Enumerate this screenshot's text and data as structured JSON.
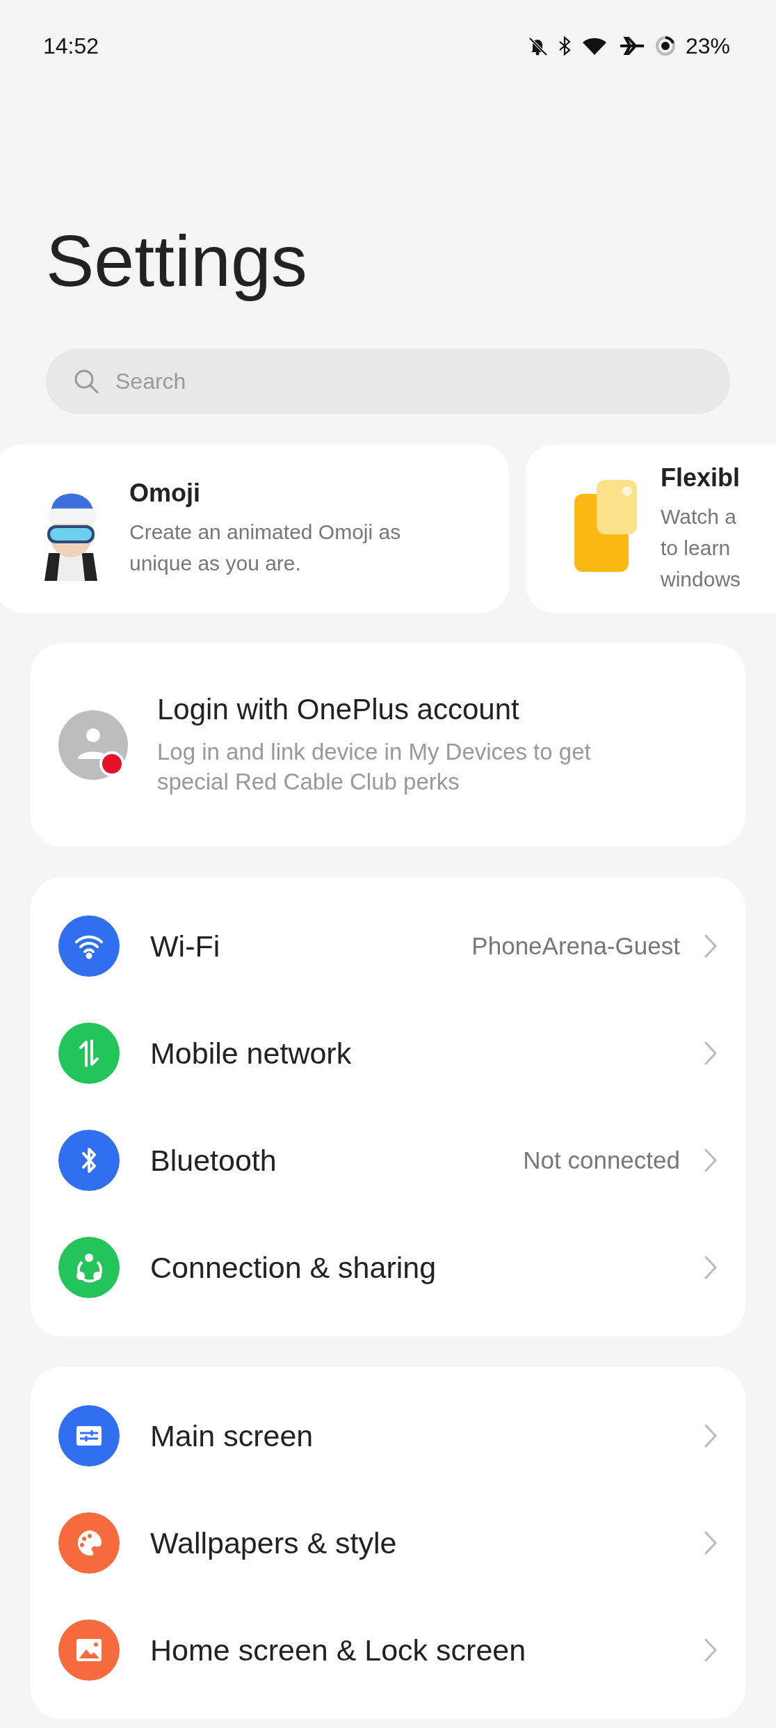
{
  "status_bar": {
    "time": "14:52",
    "battery": "23%"
  },
  "title": "Settings",
  "search": {
    "placeholder": "Search"
  },
  "promo_cards": [
    {
      "kind": "omoji",
      "title": "Omoji",
      "description_lines": [
        "Create an animated Omoji as",
        "unique as you are."
      ]
    },
    {
      "kind": "windows",
      "title": "Flexibl",
      "description_lines": [
        "Watch a",
        "to learn",
        "windows"
      ]
    }
  ],
  "account": {
    "title": "Login with OnePlus account",
    "description": "Log in and link device in My Devices to get special Red Cable Club perks",
    "alert_dot": true
  },
  "groups": [
    [
      {
        "kind": "wifi",
        "color": "#2f6ff0",
        "label": "Wi-Fi",
        "value": "PhoneArena-Guest"
      },
      {
        "kind": "mobile",
        "color": "#23c45a",
        "label": "Mobile network"
      },
      {
        "kind": "bluetooth",
        "color": "#2f6ff0",
        "label": "Bluetooth",
        "value": "Not connected"
      },
      {
        "kind": "share",
        "color": "#23c45a",
        "label": "Connection & sharing"
      }
    ],
    [
      {
        "kind": "screen",
        "color": "#2f6ff0",
        "label": "Main screen"
      },
      {
        "kind": "palette",
        "color": "#f66b3e",
        "label": "Wallpapers & style"
      },
      {
        "kind": "image",
        "color": "#f66b3e",
        "label": "Home screen & Lock screen"
      }
    ]
  ]
}
